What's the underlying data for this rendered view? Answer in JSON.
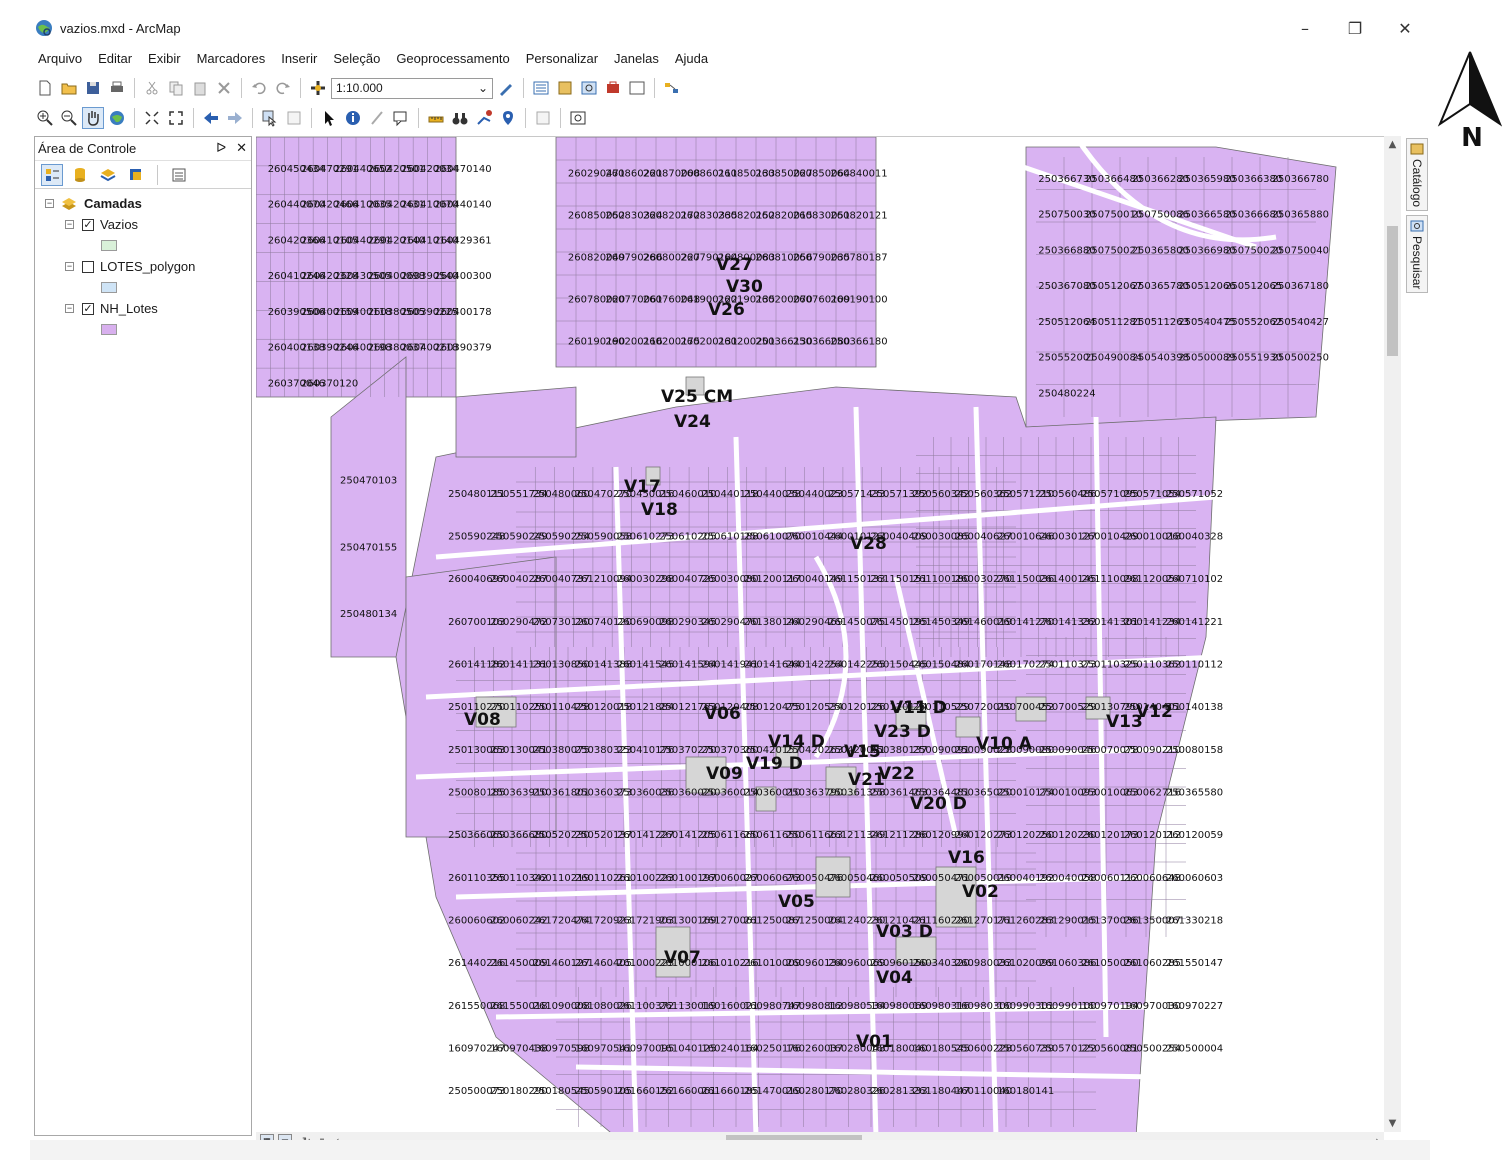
{
  "window": {
    "title": "vazios.mxd - ArcMap",
    "minimize": "–",
    "restore": "❐",
    "close": "✕"
  },
  "menu": [
    "Arquivo",
    "Editar",
    "Exibir",
    "Marcadores",
    "Inserir",
    "Seleção",
    "Geoprocessamento",
    "Personalizar",
    "Janelas",
    "Ajuda"
  ],
  "toolbar": {
    "scale": "1:10.000"
  },
  "toc": {
    "title": "Área de Controle",
    "pin": "ᐅ",
    "close": "✕",
    "root": "Camadas",
    "layers": [
      {
        "name": "Vazios",
        "checked": true,
        "mark": "✓",
        "color": "#d9f0d9"
      },
      {
        "name": "LOTES_polygon",
        "checked": false,
        "mark": "",
        "color": "#cfe4f6"
      },
      {
        "name": "NH_Lotes",
        "checked": true,
        "mark": "✓",
        "color": "#d8b0ee"
      }
    ]
  },
  "side_tabs": [
    "Catálogo",
    "Pesquisar"
  ],
  "north_arrow": "N",
  "colors": {
    "lots": "#d9b3f2",
    "lots_stroke": "#6e6e6e",
    "vazios": "#d6d6d6"
  },
  "map": {
    "void_labels": [
      "V25 CM",
      "V24",
      "V27",
      "V30",
      "V26",
      "V17",
      "V18",
      "V28",
      "V08",
      "V06",
      "V11 D",
      "V23 D",
      "V13",
      "V12",
      "V14 D",
      "V15",
      "V10 A",
      "V19 D",
      "V09",
      "V21",
      "V22",
      "V20 D",
      "V16",
      "V02",
      "V05",
      "V03 D",
      "V07",
      "V04",
      "V01"
    ],
    "lot_labels": [
      "260450434",
      "260470291",
      "260440652",
      "260420501",
      "260420034",
      "260470140",
      "260440070",
      "260420466",
      "260410035",
      "260420431",
      "260410070",
      "260440140",
      "260420366",
      "260410105",
      "260440291",
      "260420140",
      "260410140",
      "260429361",
      "260410246",
      "260420328",
      "260430505",
      "260400098",
      "260390540",
      "260400300",
      "260390506",
      "260400159",
      "260400118",
      "260380505",
      "260390225",
      "260400178",
      "260400138",
      "260390246",
      "260400198",
      "260380037",
      "260400218",
      "260390379",
      "260370046",
      "260370120",
      "260290471",
      "260860221",
      "260870008",
      "260860111",
      "260850133",
      "260850027",
      "260850064",
      "260840011",
      "260850052",
      "260830324",
      "260820172",
      "260830335",
      "260820152",
      "260820015",
      "260830051",
      "260820121",
      "260820049",
      "260790286",
      "260800227",
      "260790104",
      "260800083",
      "260810056",
      "260790035",
      "260780187",
      "260780020",
      "260770061",
      "260760048",
      "261900122",
      "260190135",
      "260200070",
      "260760109",
      "260190100",
      "260190190",
      "260200116",
      "260200175",
      "260200131",
      "260200201",
      "250366130",
      "250366080",
      "250366180",
      "250366730",
      "250366480",
      "250366280",
      "250365980",
      "250366380",
      "250366780",
      "250750030",
      "250750010",
      "250750086",
      "250366580",
      "250366680",
      "250365880",
      "250366880",
      "250750021",
      "250365800",
      "250366980",
      "250750020",
      "250750040",
      "250367080",
      "250512067",
      "250365780",
      "250512066",
      "250512065",
      "250367180",
      "250512064",
      "250511281",
      "250511263",
      "250540475",
      "250552062",
      "250540427",
      "250552001",
      "250490084",
      "250540398",
      "250500089",
      "250551930",
      "250500250",
      "250480224",
      "250470103",
      "250470155",
      "250480134",
      "250480111",
      "250551734",
      "250480060",
      "250470270",
      "250450016",
      "250460010",
      "250440118",
      "250440038",
      "250440023",
      "250571433",
      "250571392",
      "250560342",
      "250560362",
      "250571210",
      "250560486",
      "250571095",
      "250571054",
      "250571052",
      "250590248",
      "250590249",
      "250590254",
      "250590058",
      "250610273",
      "250610205",
      "250610188",
      "250610070",
      "260010444",
      "260010127",
      "260040409",
      "260030085",
      "260040627",
      "260010646",
      "260030127",
      "260010429",
      "260010018",
      "260040328",
      "260040697",
      "260040287",
      "260040737",
      "261210094",
      "260030298",
      "260040725",
      "260030080",
      "261200117",
      "260040149",
      "261150133",
      "261150151",
      "261100180",
      "260030270",
      "261150036",
      "261400145",
      "261110098",
      "261120054",
      "260710102",
      "260700103",
      "260290472",
      "260730120",
      "260740120",
      "260690098",
      "260290345",
      "260290470",
      "261380144",
      "260290469",
      "261450075",
      "261450195",
      "261450349",
      "261460019",
      "260141270",
      "260141332",
      "260141301",
      "260141234",
      "260141221",
      "260141182",
      "260141131",
      "260130850",
      "260141388",
      "260141545",
      "260141594",
      "260141941",
      "260141644",
      "260142254",
      "260142255",
      "260150445",
      "260150484",
      "260170148",
      "260170274",
      "250110373",
      "250110325",
      "250110362",
      "250110112",
      "250110270",
      "250110250",
      "250110428",
      "250120018",
      "250121884",
      "250121763",
      "250120408",
      "250120475",
      "250120534",
      "250120126",
      "250120124",
      "250110529",
      "250720010",
      "250700452",
      "250700529",
      "250130790",
      "250140401",
      "250140138",
      "250130063",
      "250130041",
      "250380075",
      "250380323",
      "250410176",
      "250370270",
      "250370360",
      "250420157",
      "250420263",
      "250420001",
      "250380137",
      "250090091",
      "250090028",
      "250090080",
      "250090046",
      "250070078",
      "250090210",
      "250080158",
      "250080185",
      "250363910",
      "250361801",
      "250360373",
      "250360036",
      "250360020",
      "250360014",
      "250360010",
      "250363790",
      "250361358",
      "250361463",
      "250364481",
      "250365020",
      "250010174",
      "250010093",
      "250010063",
      "250062716",
      "250365580",
      "250366069",
      "250366680",
      "250520230",
      "250520137",
      "260141227",
      "260141205",
      "250611660",
      "250611650",
      "250611663",
      "261211349",
      "261211286",
      "260120994",
      "260120273",
      "260120250",
      "260120230",
      "260120173",
      "260120112",
      "260120059",
      "260110355",
      "260110342",
      "260110219",
      "260110261",
      "260100223",
      "260100197",
      "260060027",
      "260060673",
      "260050476",
      "260050460",
      "260050509",
      "260050471",
      "260050019",
      "260040192",
      "260040058",
      "260060112",
      "260060648",
      "260060603",
      "260060602",
      "260060242",
      "261720474",
      "261720923",
      "261721903",
      "261300169",
      "261270061",
      "261250087",
      "261250004",
      "261240230",
      "261210421",
      "261160220",
      "261270171",
      "261260283",
      "261290015",
      "261370036",
      "261350007",
      "261330218",
      "261440216",
      "261450009",
      "261460127",
      "261460405",
      "261000223",
      "261000106",
      "261010216",
      "261010009",
      "260960134",
      "260960069",
      "260960150",
      "260340320",
      "260980033",
      "261020099",
      "261060386",
      "261050050",
      "261060285",
      "261550147",
      "261550068",
      "261550018",
      "261090008",
      "261080026",
      "261100372",
      "261130019",
      "160160021",
      "160980747",
      "160980812",
      "160980534",
      "160980069",
      "160980316",
      "160980300",
      "160990301",
      "160990100",
      "160970194",
      "160970030",
      "160970227",
      "160970247",
      "160970438",
      "160970598",
      "160970541",
      "160970095",
      "161040125",
      "160240164",
      "160250176",
      "160260037",
      "160280048",
      "160180040",
      "160180545",
      "250600228",
      "250560739",
      "250570122",
      "250560081",
      "250500254",
      "250500004",
      "250500073",
      "250180290",
      "250180545",
      "250590105",
      "261660152",
      "261660061",
      "261660185",
      "261470019",
      "260280170",
      "260280326",
      "260281333",
      "261180447",
      "160110040",
      "160180141"
    ]
  }
}
